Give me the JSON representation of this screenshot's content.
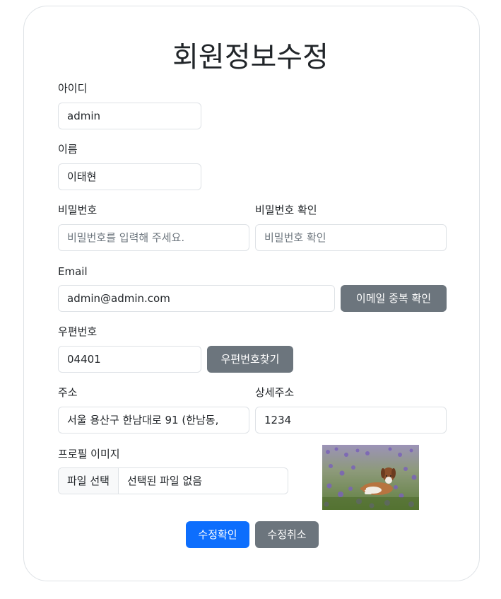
{
  "title": "회원정보수정",
  "fields": {
    "id_label": "아이디",
    "id_value": "admin",
    "name_label": "이름",
    "name_value": "이태현",
    "password_label": "비밀번호",
    "password_placeholder": "비밀번호를 입력해 주세요.",
    "password_confirm_label": "비밀번호 확인",
    "password_confirm_placeholder": "비밀번호 확인",
    "email_label": "Email",
    "email_value": "admin@admin.com",
    "email_check_button": "이메일 중복 확인",
    "zipcode_label": "우편번호",
    "zipcode_value": "04401",
    "zipcode_search_button": "우편번호찾기",
    "address_label": "주소",
    "address_value": "서울 용산구 한남대로 91 (한남동,",
    "address_detail_label": "상세주소",
    "address_detail_value": "1234",
    "profile_label": "프로필 이미지",
    "file_button": "파일 선택",
    "file_status": "선택된 파일 없음"
  },
  "actions": {
    "submit": "수정확인",
    "cancel": "수정취소"
  },
  "colors": {
    "primary": "#0d6efd",
    "secondary": "#6c757d",
    "border": "#dee2e6"
  }
}
